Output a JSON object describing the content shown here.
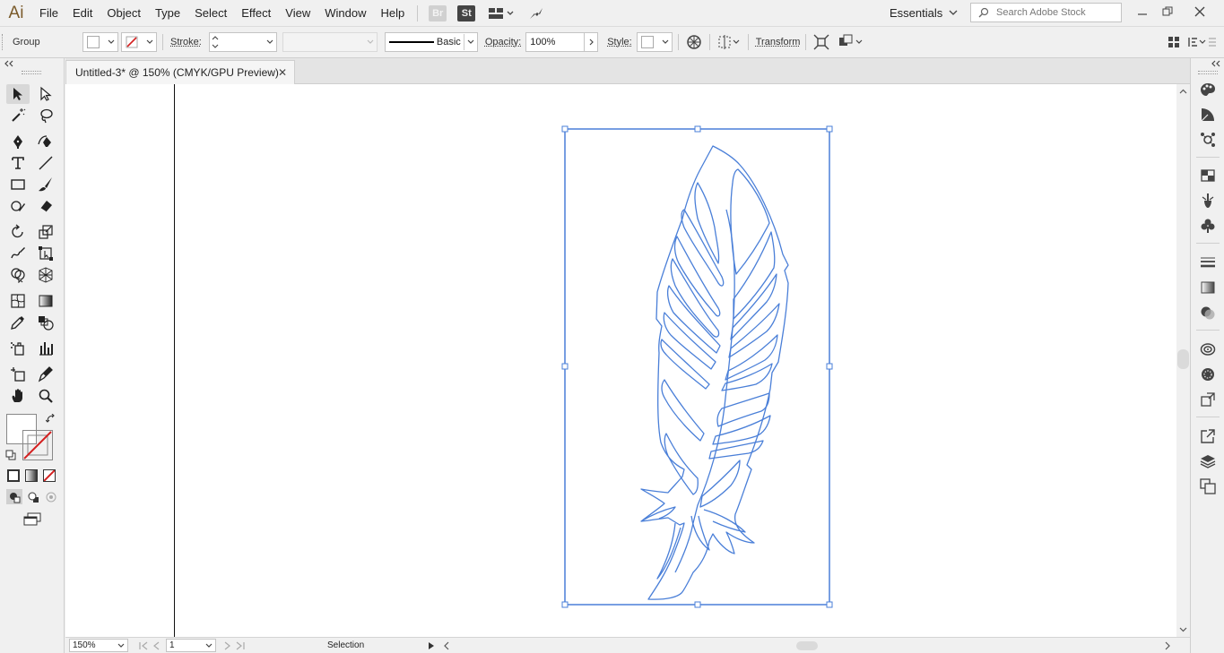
{
  "app": {
    "logo": "Ai"
  },
  "menu": [
    "File",
    "Edit",
    "Object",
    "Type",
    "Select",
    "Effect",
    "View",
    "Window",
    "Help"
  ],
  "menubar_icons": {
    "bridge": "Br",
    "stock": "St"
  },
  "workspace": {
    "label": "Essentials"
  },
  "search": {
    "placeholder": "Search Adobe Stock"
  },
  "control": {
    "selection_type": "Group",
    "stroke_label": "Stroke:",
    "brush_label": "Basic",
    "opacity_label": "Opacity:",
    "opacity_value": "100%",
    "style_label": "Style:",
    "transform_label": "Transform"
  },
  "document": {
    "tab_title": "Untitled-3* @ 150% (CMYK/GPU Preview)",
    "close_glyph": "✕"
  },
  "status": {
    "zoom": "150%",
    "artboard_number": "1",
    "tool_name": "Selection"
  },
  "colors": {
    "selection": "#4a7fd8",
    "accent_fill_none": "#d42020"
  },
  "tools": [
    "selection-tool",
    "direct-selection-tool",
    "magic-wand-tool",
    "lasso-tool",
    "pen-tool",
    "curvature-tool",
    "type-tool",
    "line-segment-tool",
    "rectangle-tool",
    "paintbrush-tool",
    "shaper-tool",
    "eraser-tool",
    "rotate-tool",
    "scale-tool",
    "warp-tool",
    "free-transform-tool",
    "shape-builder-tool",
    "perspective-grid-tool",
    "mesh-tool",
    "gradient-tool",
    "eyedropper-tool",
    "blend-tool",
    "symbol-sprayer-tool",
    "column-graph-tool",
    "artboard-tool",
    "slice-tool",
    "hand-tool",
    "zoom-tool"
  ],
  "right_panels": [
    "color-panel-icon",
    "color-guide-icon",
    "cc-libraries-icon",
    "swatches-icon",
    "brushes-icon",
    "symbols-icon",
    "stroke-panel-icon",
    "gradient-panel-icon",
    "transparency-panel-icon",
    "appearance-panel-icon",
    "graphic-styles-icon",
    "asset-export-icon",
    "export-icon",
    "layers-icon",
    "artboards-icon"
  ]
}
